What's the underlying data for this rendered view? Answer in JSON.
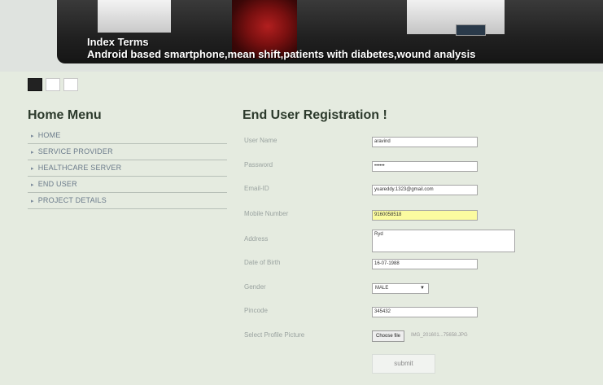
{
  "banner": {
    "title_line1": "Index Terms",
    "title_line2": "Android based smartphone,mean shift,patients with diabetes,wound analysis"
  },
  "slider": {
    "dots": 3,
    "active_index": 0
  },
  "sidebar": {
    "heading": "Home Menu",
    "items": [
      {
        "label": "HOME"
      },
      {
        "label": "SERVICE PROVIDER"
      },
      {
        "label": "HEALTHCARE SERVER"
      },
      {
        "label": "END USER"
      },
      {
        "label": "PROJECT DETAILS"
      }
    ]
  },
  "form": {
    "title": "End User Registration !",
    "username": {
      "label": "User Name",
      "value": "aravind"
    },
    "password": {
      "label": "Password",
      "value": "••••••"
    },
    "email": {
      "label": "Email-ID",
      "value": "yuareddy.1323@gmail.com"
    },
    "mobile": {
      "label": "Mobile Number",
      "value": "9160058518"
    },
    "address": {
      "label": "Address",
      "value": "Ryd"
    },
    "dob": {
      "label": "Date of Birth",
      "value": "16-07-1988"
    },
    "gender": {
      "label": "Gender",
      "value": "MALE"
    },
    "pincode": {
      "label": "Pincode",
      "value": "345432"
    },
    "picture": {
      "label": "Select Profile Picture",
      "button": "Choose file",
      "filename": "IMG_201601...75658.JPG"
    },
    "submit": "submit"
  },
  "icons": {
    "dropdown": "caret-down-icon",
    "menu_bullet": "arrow-right-icon"
  }
}
